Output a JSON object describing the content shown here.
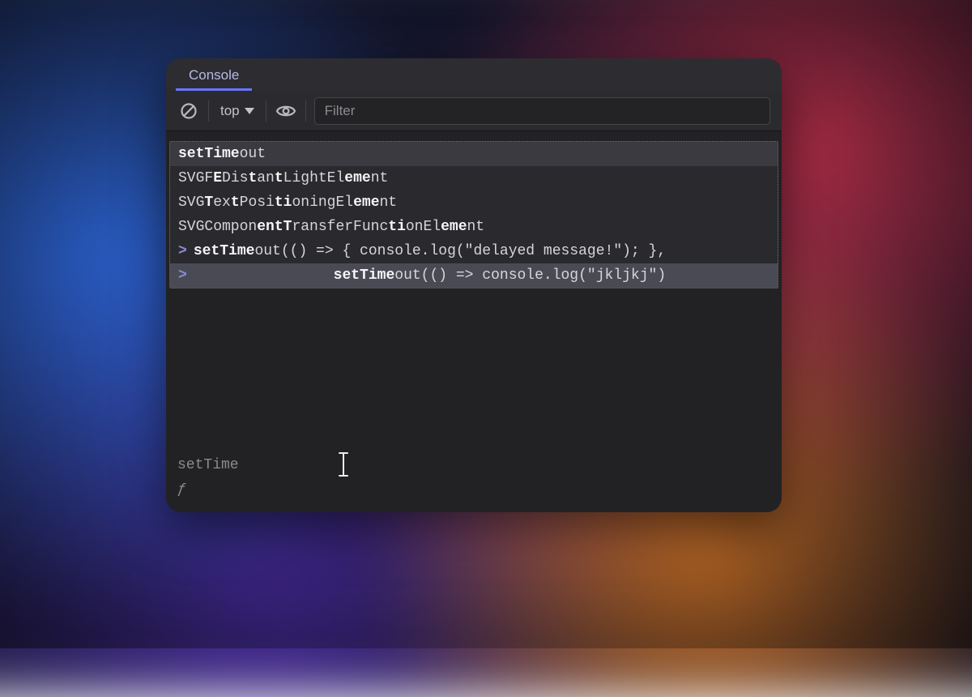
{
  "tab": {
    "title": "Console"
  },
  "toolbar": {
    "context_label": "top",
    "filter_placeholder": "Filter"
  },
  "autocomplete": {
    "items": [
      {
        "pre": "",
        "match": "setTime",
        "post": "out"
      },
      {
        "pre": "SVGF",
        "match": "E",
        "post": "Dis",
        "match2": "t",
        "post2": "an",
        "match3": "t",
        "post3": "LightEl",
        "match4": "eme",
        "post4": "nt"
      },
      {
        "pre": "SVG",
        "match": "T",
        "post": "ex",
        "match2": "t",
        "post2": "Posi",
        "match3": "ti",
        "post3": "oningEl",
        "match4": "eme",
        "post4": "nt"
      },
      {
        "pre": "SVGCompon",
        "match": "entT",
        "post": "ransferFunc",
        "match2": "ti",
        "post2": "onEl",
        "match3": "eme",
        "post3": "nt"
      }
    ],
    "history": [
      {
        "code_pre": "",
        "bold": "setTime",
        "code_post": "out(() => { console.log(\"delayed message!\"); },"
      },
      {
        "indent": "                ",
        "bold": "setTime",
        "code_post": "out(() => console.log(\"jkljkj\")"
      }
    ]
  },
  "input": {
    "typed": "setTime",
    "return_glyph": "ƒ"
  }
}
